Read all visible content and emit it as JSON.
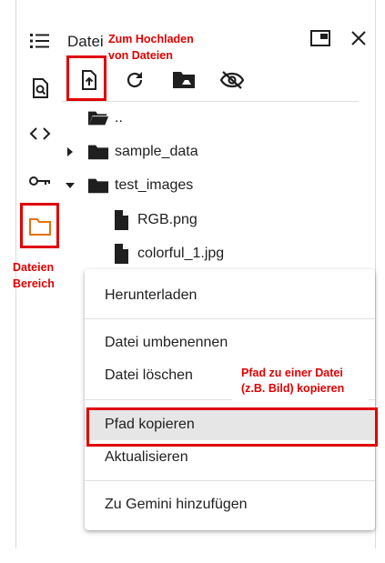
{
  "panel": {
    "title": "Dateien"
  },
  "tree": {
    "parent": "..",
    "items": [
      {
        "name": "sample_data"
      },
      {
        "name": "test_images"
      },
      {
        "name": "RGB.png"
      },
      {
        "name": "colorful_1.jpg"
      }
    ]
  },
  "context_menu": {
    "items": [
      {
        "label": "Herunterladen"
      },
      {
        "label": "Datei umbenennen"
      },
      {
        "label": "Datei löschen"
      },
      {
        "label": "Pfad kopieren"
      },
      {
        "label": "Aktualisieren"
      },
      {
        "label": "Zu Gemini hinzufügen"
      }
    ]
  },
  "annotations": {
    "upload_line1": "Zum Hochladen",
    "upload_line2": "von Dateien",
    "files_line1": "Dateien",
    "files_line2": "Bereich",
    "path_line1": "Pfad zu einer Datei",
    "path_line2": "(z.B. Bild) kopieren"
  },
  "colors": {
    "annotation_red": "#e00000",
    "files_icon_orange": "#e8710a",
    "icon_dark": "#1f1f1f",
    "menu_highlight": "#e6e6e6"
  }
}
